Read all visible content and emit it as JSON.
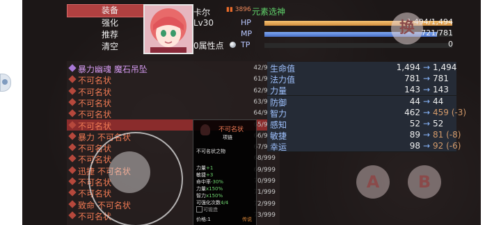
{
  "menu": [
    "装备",
    "强化",
    "推荐",
    "清空"
  ],
  "character": {
    "name": "卡尔",
    "level": "Lv30",
    "power": "3896",
    "element": "元素选神",
    "attr_points": "0属性点",
    "hp_label": "HP",
    "hp_value": "1,494/1,494",
    "hp_ratio": 1.0,
    "mp_label": "MP",
    "mp_value": "721/781",
    "mp_ratio": 0.92,
    "tp_label": "TP",
    "tp_value": "0",
    "tp_ratio": 0
  },
  "swap_button": "换",
  "equipment": [
    {
      "name": "暴力幽魂 魔石吊坠",
      "count": "42/999",
      "color": "purple"
    },
    {
      "name": "不可名状",
      "count": "61/999"
    },
    {
      "name": "不可名状",
      "count": "62/999"
    },
    {
      "name": "不可名状",
      "count": "63/999"
    },
    {
      "name": "不可名状",
      "count": "64/999"
    },
    {
      "name": "不可名状",
      "count": "65/999",
      "selected": true
    },
    {
      "name": "暴力 不可名状",
      "count": "66/999"
    },
    {
      "name": "不可名状",
      "count": "67/999"
    },
    {
      "name": "不可名状",
      "count": "68/999"
    },
    {
      "name": "迅捷 不可名状",
      "count": "69/999"
    },
    {
      "name": "不可名状",
      "count": "70/999"
    },
    {
      "name": "不可名状",
      "count": "71/999"
    },
    {
      "name": "致命 不可名状",
      "count": "72/999"
    },
    {
      "name": "不可名状",
      "count": "73/999"
    }
  ],
  "stats": [
    {
      "name": "生命值",
      "current": "1,494",
      "arrow": "→",
      "new": "1,494"
    },
    {
      "name": "法力值",
      "current": "781",
      "arrow": "→",
      "new": "781"
    },
    {
      "name": "力量",
      "current": "143",
      "arrow": "→",
      "new": "143"
    },
    {
      "name": "防御",
      "current": "44",
      "arrow": "→",
      "new": "44"
    },
    {
      "name": "智力",
      "current": "462",
      "arrow": "→",
      "new": "459 (-3)",
      "down": true
    },
    {
      "name": "感知",
      "current": "52",
      "arrow": "→",
      "new": "52"
    },
    {
      "name": "敏捷",
      "current": "89",
      "arrow": "→",
      "new": "81 (-8)",
      "down": true
    },
    {
      "name": "幸运",
      "current": "98",
      "arrow": "→",
      "new": "92 (-6)",
      "down": true
    }
  ],
  "tooltip": {
    "title": "不可名状",
    "subtitle": "项链",
    "description": "不可名状之物",
    "lines": [
      {
        "label": "力量",
        "value": "+1"
      },
      {
        "label": "敏捷",
        "value": "+3"
      },
      {
        "label": "命中率",
        "value": "-30%"
      },
      {
        "label": "力量",
        "value": "x150%"
      },
      {
        "label": "智力",
        "value": "x150%"
      },
      {
        "label": "可强化次数",
        "value": "4/4"
      }
    ],
    "checkbox_label": "可锻造",
    "price": "价格:1",
    "rarity": "传说"
  },
  "buttons": {
    "a": "A",
    "b": "B"
  }
}
